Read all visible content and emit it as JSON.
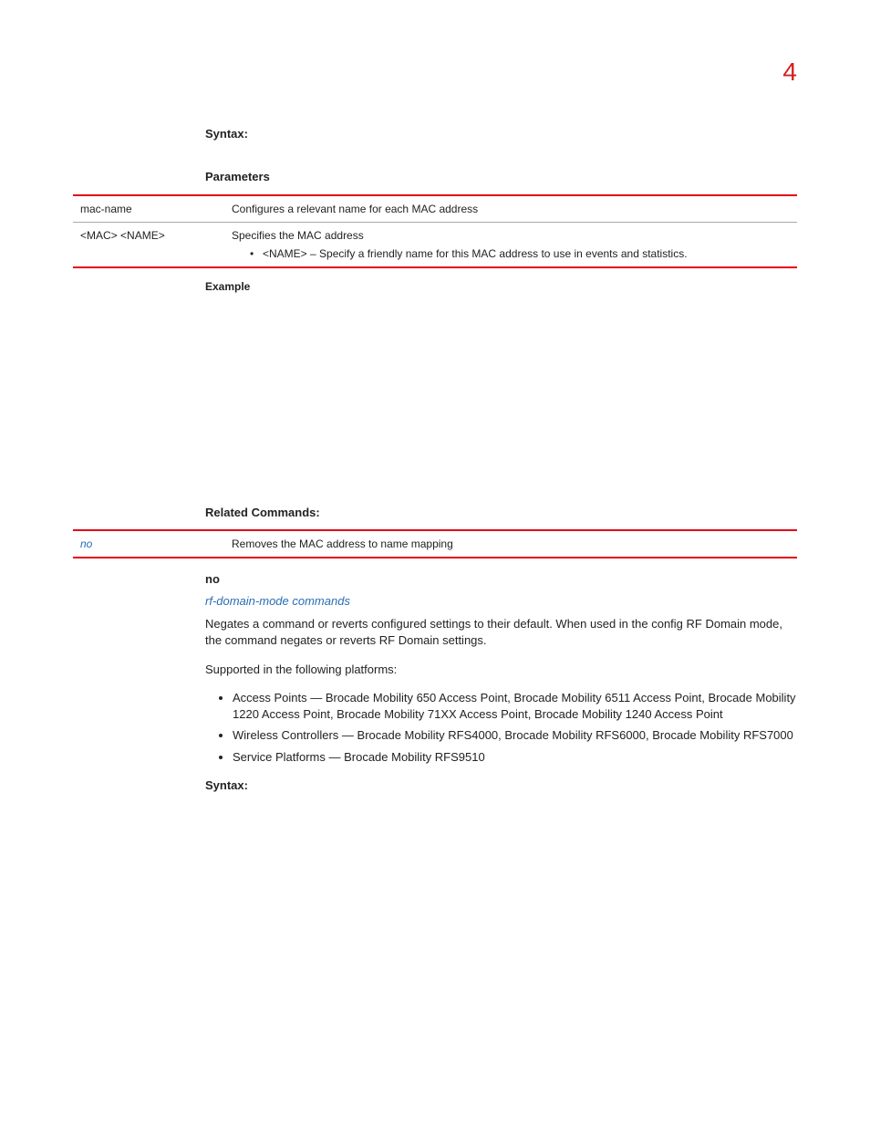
{
  "page_number": "4",
  "syntax1_heading": "Syntax:",
  "parameters_heading": "Parameters",
  "param_table": {
    "row1": {
      "name": "mac-name",
      "desc": "Configures a relevant name for each MAC address"
    },
    "row2": {
      "name": "<MAC> <NAME>",
      "desc": "Specifies the MAC address",
      "sub": "<NAME> – Specify a friendly name for this MAC address to use in events and statistics."
    }
  },
  "example_heading": "Example",
  "related_heading": "Related Commands:",
  "related_table": {
    "row1": {
      "name": "no",
      "desc": "Removes the MAC address to name mapping"
    }
  },
  "no_heading": "no",
  "no_link": "rf-domain-mode commands",
  "no_para": "Negates a command or reverts configured settings to their default. When used in the config RF Domain mode, the       command negates or reverts RF Domain settings.",
  "supported_intro": "Supported in the following platforms:",
  "platforms": [
    "Access Points — Brocade Mobility 650 Access Point, Brocade Mobility 6511 Access Point, Brocade Mobility 1220 Access Point, Brocade Mobility 71XX Access Point, Brocade Mobility 1240 Access Point",
    "Wireless Controllers — Brocade Mobility RFS4000, Brocade Mobility RFS6000, Brocade Mobility RFS7000",
    "Service Platforms — Brocade Mobility RFS9510"
  ],
  "syntax2_heading": "Syntax:"
}
